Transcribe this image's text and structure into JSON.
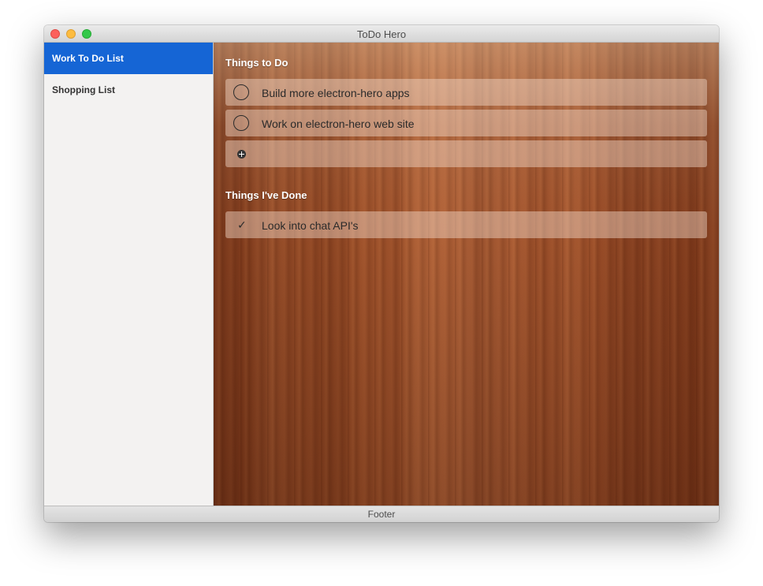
{
  "window": {
    "title": "ToDo Hero"
  },
  "sidebar": {
    "items": [
      {
        "label": "Work To Do List",
        "active": true
      },
      {
        "label": "Shopping List",
        "active": false
      }
    ]
  },
  "main": {
    "todo_title": "Things to Do",
    "todo_items": [
      {
        "label": "Build more electron-hero apps",
        "icon": "circle-icon"
      },
      {
        "label": "Work on electron-hero web site",
        "icon": "circle-icon"
      }
    ],
    "add_item": {
      "icon": "plus-circle-icon",
      "value": ""
    },
    "done_title": "Things I've Done",
    "done_items": [
      {
        "label": "Look into chat API's",
        "icon": "checkmark-icon"
      }
    ]
  },
  "footer": {
    "label": "Footer"
  },
  "colors": {
    "sidebar_active": "#1565d5",
    "close": "#fc605c",
    "minimize": "#fdbc40",
    "zoom": "#34c84a"
  }
}
